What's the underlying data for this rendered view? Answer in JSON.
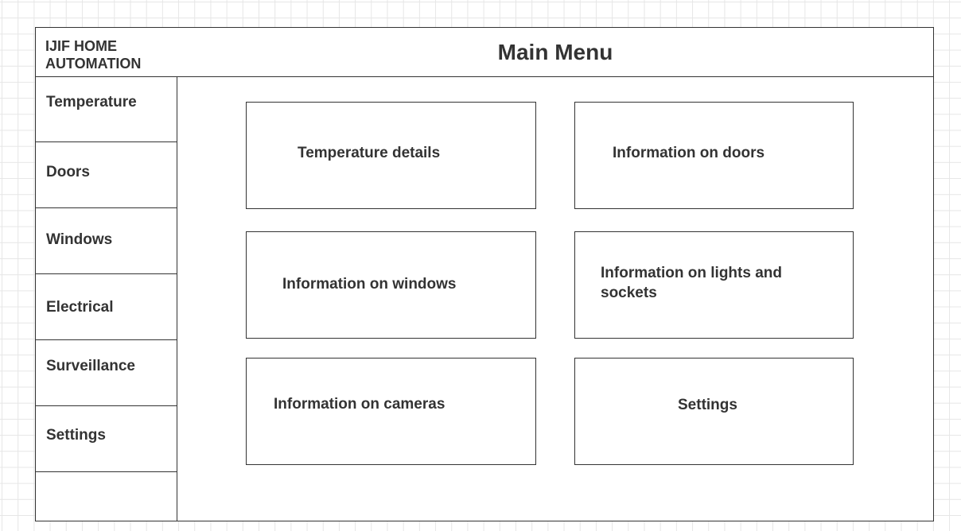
{
  "header": {
    "brand_line1": "IJIF HOME",
    "brand_line2": "AUTOMATION",
    "title": "Main Menu"
  },
  "sidebar": {
    "items": [
      {
        "label": "Temperature"
      },
      {
        "label": "Doors"
      },
      {
        "label": "Windows"
      },
      {
        "label": "Electrical"
      },
      {
        "label": "Surveillance"
      },
      {
        "label": "Settings"
      }
    ]
  },
  "cards": [
    {
      "label": "Temperature details"
    },
    {
      "label": "Information on doors"
    },
    {
      "label": "Information on windows"
    },
    {
      "label": "Information on lights and sockets"
    },
    {
      "label": "Information on cameras"
    },
    {
      "label": "Settings"
    }
  ]
}
